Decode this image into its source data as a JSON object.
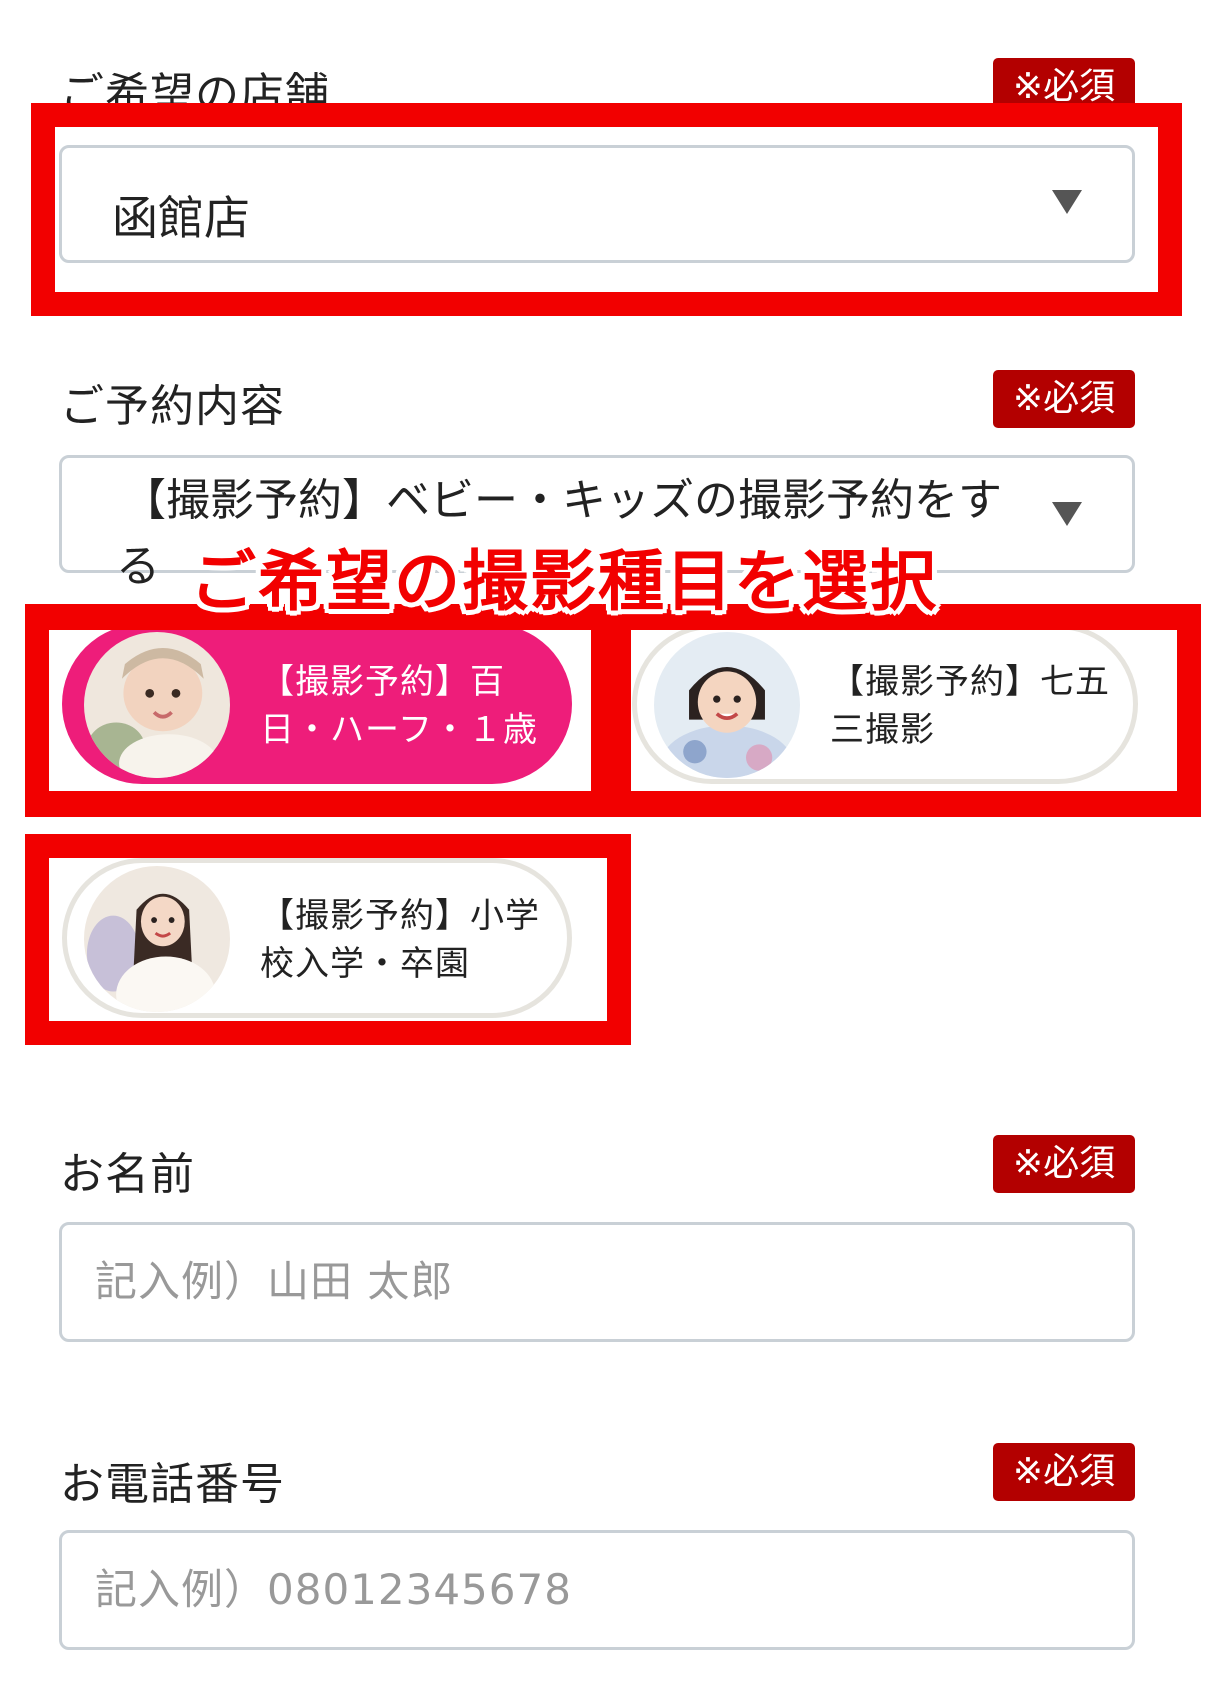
{
  "store": {
    "label": "ご希望の店舗",
    "required": "※必須",
    "selected": "函館店"
  },
  "reservation": {
    "label": "ご予約内容",
    "required": "※必須",
    "selected_line1": "【撮影予約】ベビー・キッズの撮影予約をす",
    "selected_line2": "る",
    "options": [
      {
        "line1": "【撮影予約】百",
        "line2": "日・ハーフ・１歳",
        "selected": true
      },
      {
        "line1": "【撮影予約】七五",
        "line2": "三撮影",
        "selected": false
      },
      {
        "line1": "【撮影予約】小学",
        "line2": "校入学・卒園",
        "selected": false
      }
    ]
  },
  "annotation": "ご希望の撮影種目を選択",
  "name": {
    "label": "お名前",
    "required": "※必須",
    "placeholder": "記入例）山田 太郎"
  },
  "phone": {
    "label": "お電話番号",
    "required": "※必須",
    "placeholder": "記入例）08012345678"
  },
  "colors": {
    "highlight": "#f20000",
    "badge": "#b30000",
    "selected_option": "#ee1d7a"
  }
}
